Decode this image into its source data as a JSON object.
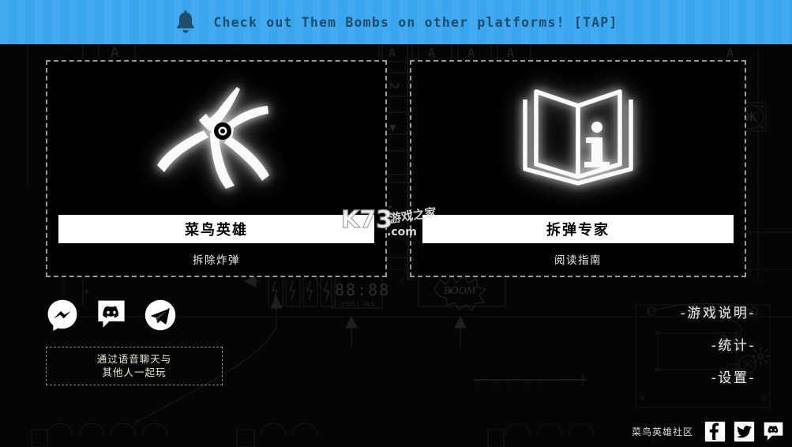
{
  "banner": {
    "icon": "bell-icon",
    "text": "Check out Them Bombs on other platforms! [TAP]",
    "background_color": "#3aa6ef",
    "text_color": "#1f4d6b"
  },
  "panels": [
    {
      "id": "rookie",
      "icon": "pliers-icon",
      "cta_label": "菜鸟英雄",
      "subtitle": "拆除炸弹"
    },
    {
      "id": "expert",
      "icon": "manual-book-info-icon",
      "cta_label": "拆弹专家",
      "subtitle": "阅读指南"
    }
  ],
  "social_left": [
    {
      "name": "messenger-icon",
      "label": "Messenger"
    },
    {
      "name": "discord-icon",
      "label": "Discord"
    },
    {
      "name": "telegram-icon",
      "label": "Telegram"
    }
  ],
  "voice_chat_note": {
    "line1": "通过语音聊天与",
    "line2": "其他人一起玩"
  },
  "menu": [
    {
      "name": "menu-instructions",
      "label": "-游戏说明-"
    },
    {
      "name": "menu-statistics",
      "label": "-统计-"
    },
    {
      "name": "menu-settings",
      "label": "-设置-"
    }
  ],
  "community": {
    "label": "菜鸟英雄社区",
    "icons": [
      {
        "name": "facebook-icon",
        "label": "Facebook"
      },
      {
        "name": "twitter-icon",
        "label": "Twitter"
      },
      {
        "name": "discord-icon",
        "label": "Discord"
      }
    ]
  },
  "watermark": {
    "primary": "K73",
    "suffix": ".com",
    "secondary": "游戏之家"
  },
  "background_art": {
    "labels": [
      "A",
      "A",
      "A",
      "A",
      "OK",
      "BOOM",
      "88:88",
      "T-53051-PLU"
    ]
  },
  "colors": {
    "page_background": "#000000",
    "panel_border": "#9a9a9a",
    "cta_background": "#ffffff",
    "accent_blue": "#3aa6ef"
  }
}
